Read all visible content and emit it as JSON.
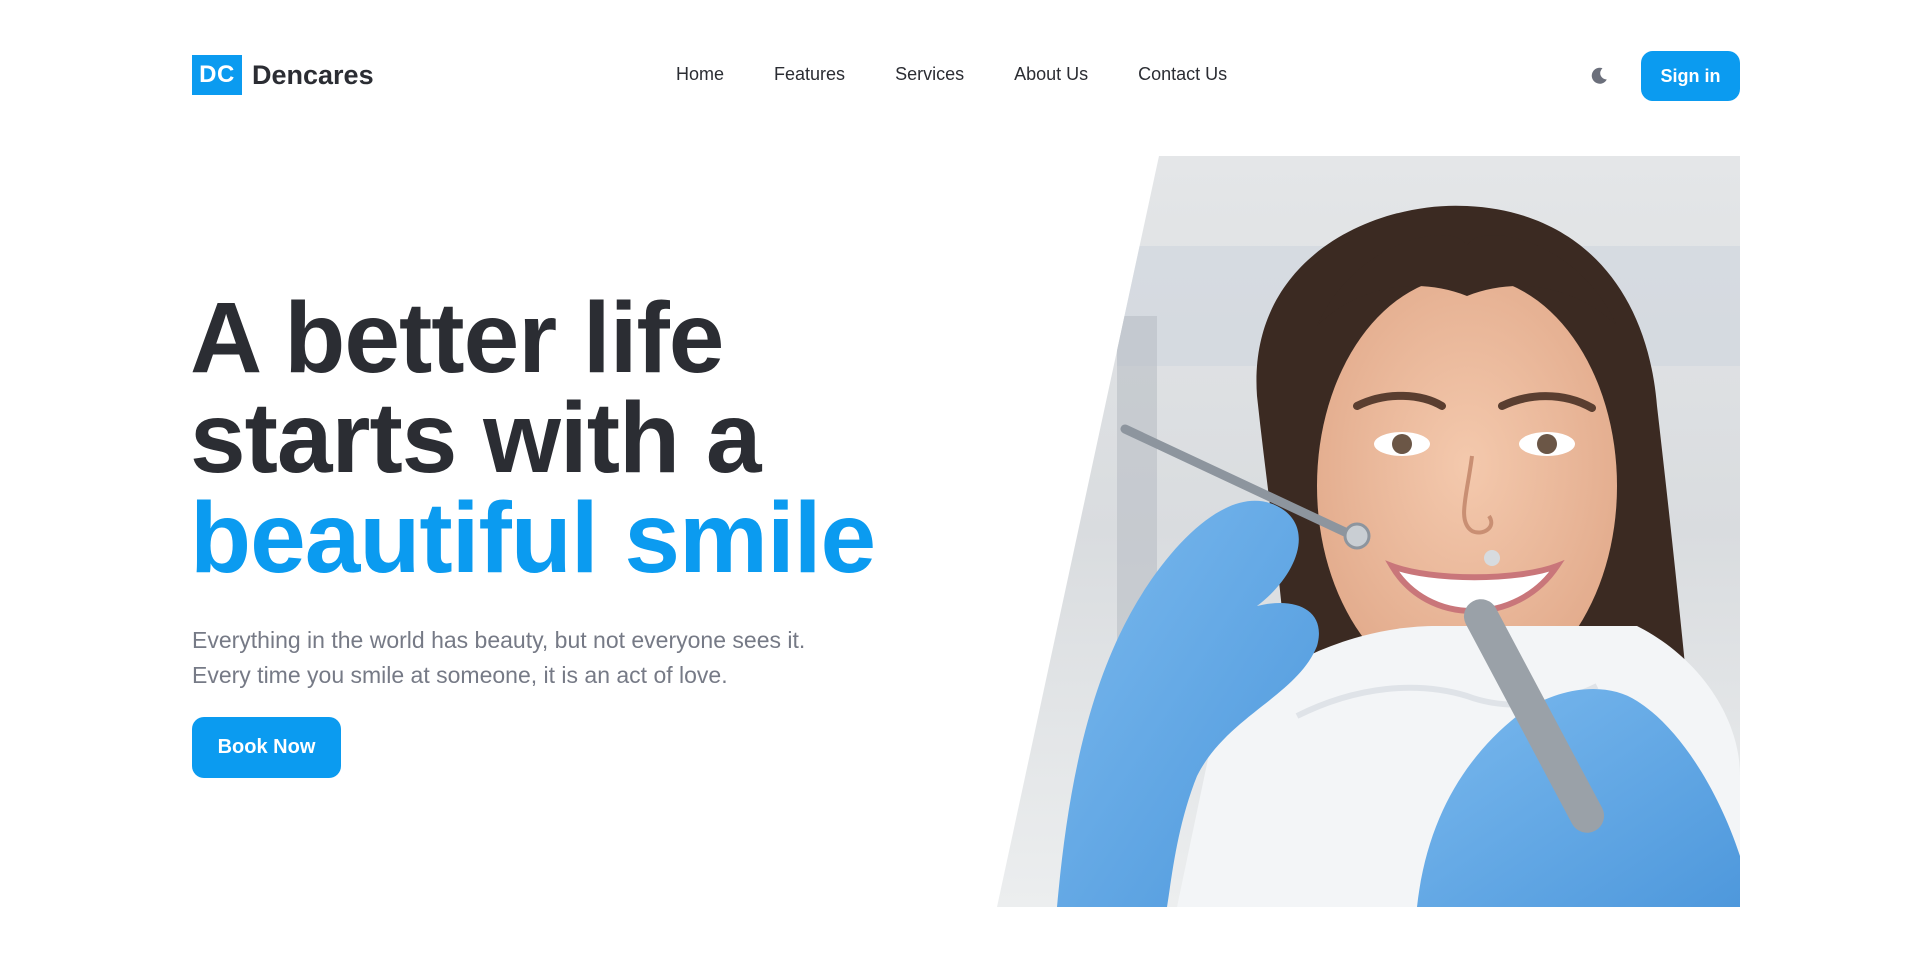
{
  "brand": {
    "logo_text": "DC",
    "name": "Dencares"
  },
  "nav": {
    "items": [
      {
        "label": "Home"
      },
      {
        "label": "Features"
      },
      {
        "label": "Services"
      },
      {
        "label": "About Us"
      },
      {
        "label": "Contact Us"
      }
    ]
  },
  "header": {
    "theme_toggle_icon": "moon-icon",
    "signin_label": "Sign in"
  },
  "hero": {
    "title_line1": "A better life",
    "title_line2": "starts with a",
    "title_accent": "beautiful smile",
    "subtitle_line1": "Everything in the world has beauty, but not everyone sees it.",
    "subtitle_line2": "Every time you smile at someone, it is an act of love.",
    "cta_label": "Book Now",
    "image_icon": "dental-patient-photo"
  },
  "colors": {
    "accent": "#0b9bf0",
    "text_dark": "#2b2d33",
    "text_muted": "#767a86",
    "glove_blue": "#5aa8e8"
  }
}
